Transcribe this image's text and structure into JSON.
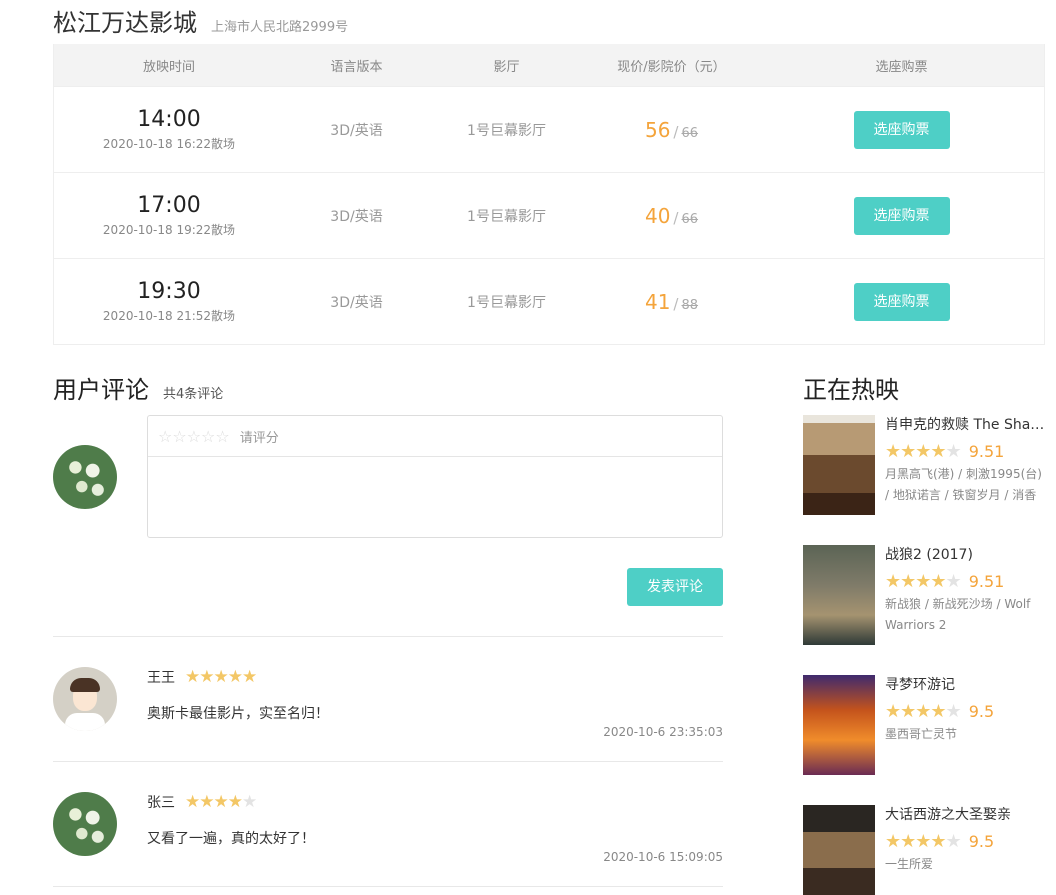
{
  "cinema": {
    "name": "松江万达影城",
    "address": "上海市人民北路2999号"
  },
  "schedule": {
    "headers": [
      "放映时间",
      "语言版本",
      "影厅",
      "现价/影院价（元）",
      "选座购票"
    ],
    "rows": [
      {
        "time": "14:00",
        "end": "2020-10-18 16:22散场",
        "lang": "3D/英语",
        "hall": "1号巨幕影厅",
        "price": "56",
        "old_price": "66",
        "button": "选座购票"
      },
      {
        "time": "17:00",
        "end": "2020-10-18 19:22散场",
        "lang": "3D/英语",
        "hall": "1号巨幕影厅",
        "price": "40",
        "old_price": "66",
        "button": "选座购票"
      },
      {
        "time": "19:30",
        "end": "2020-10-18 21:52散场",
        "lang": "3D/英语",
        "hall": "1号巨幕影厅",
        "price": "41",
        "old_price": "88",
        "button": "选座购票"
      }
    ]
  },
  "comments_section": {
    "title": "用户评论",
    "count": "共4条评论",
    "rate_hint": "请评分",
    "post_button": "发表评论",
    "items": [
      {
        "user": "王王",
        "rating": 5,
        "text": "奥斯卡最佳影片，实至名归！",
        "time": "2020-10-6 23:35:03",
        "avatar": "cartoon-avatar"
      },
      {
        "user": "张三",
        "rating": 4.5,
        "text": "又看了一遍，真的太好了！",
        "time": "2020-10-6 15:09:05",
        "avatar": "flower-avatar"
      }
    ]
  },
  "hot": {
    "title": "正在热映",
    "movies": [
      {
        "name": "肖申克的救赎 The Shawshank Redemption",
        "score": "9.51",
        "rating": 4.5,
        "alias": "月黑高飞(港) / 刺激1995(台) / 地狱诺言 / 铁窗岁月 / 消香"
      },
      {
        "name": "战狼2 (2017)",
        "score": "9.51",
        "rating": 4.5,
        "alias": "新战狼 / 新战死沙场 / Wolf Warriors 2"
      },
      {
        "name": "寻梦环游记",
        "score": "9.5",
        "rating": 4.5,
        "alias": "墨西哥亡灵节"
      },
      {
        "name": "大话西游之大圣娶亲",
        "score": "9.5",
        "rating": 4.5,
        "alias": "一生所爱"
      }
    ]
  },
  "colors": {
    "accent": "#4ecfc6",
    "price": "#f4a43b",
    "star": "#f3c766"
  }
}
